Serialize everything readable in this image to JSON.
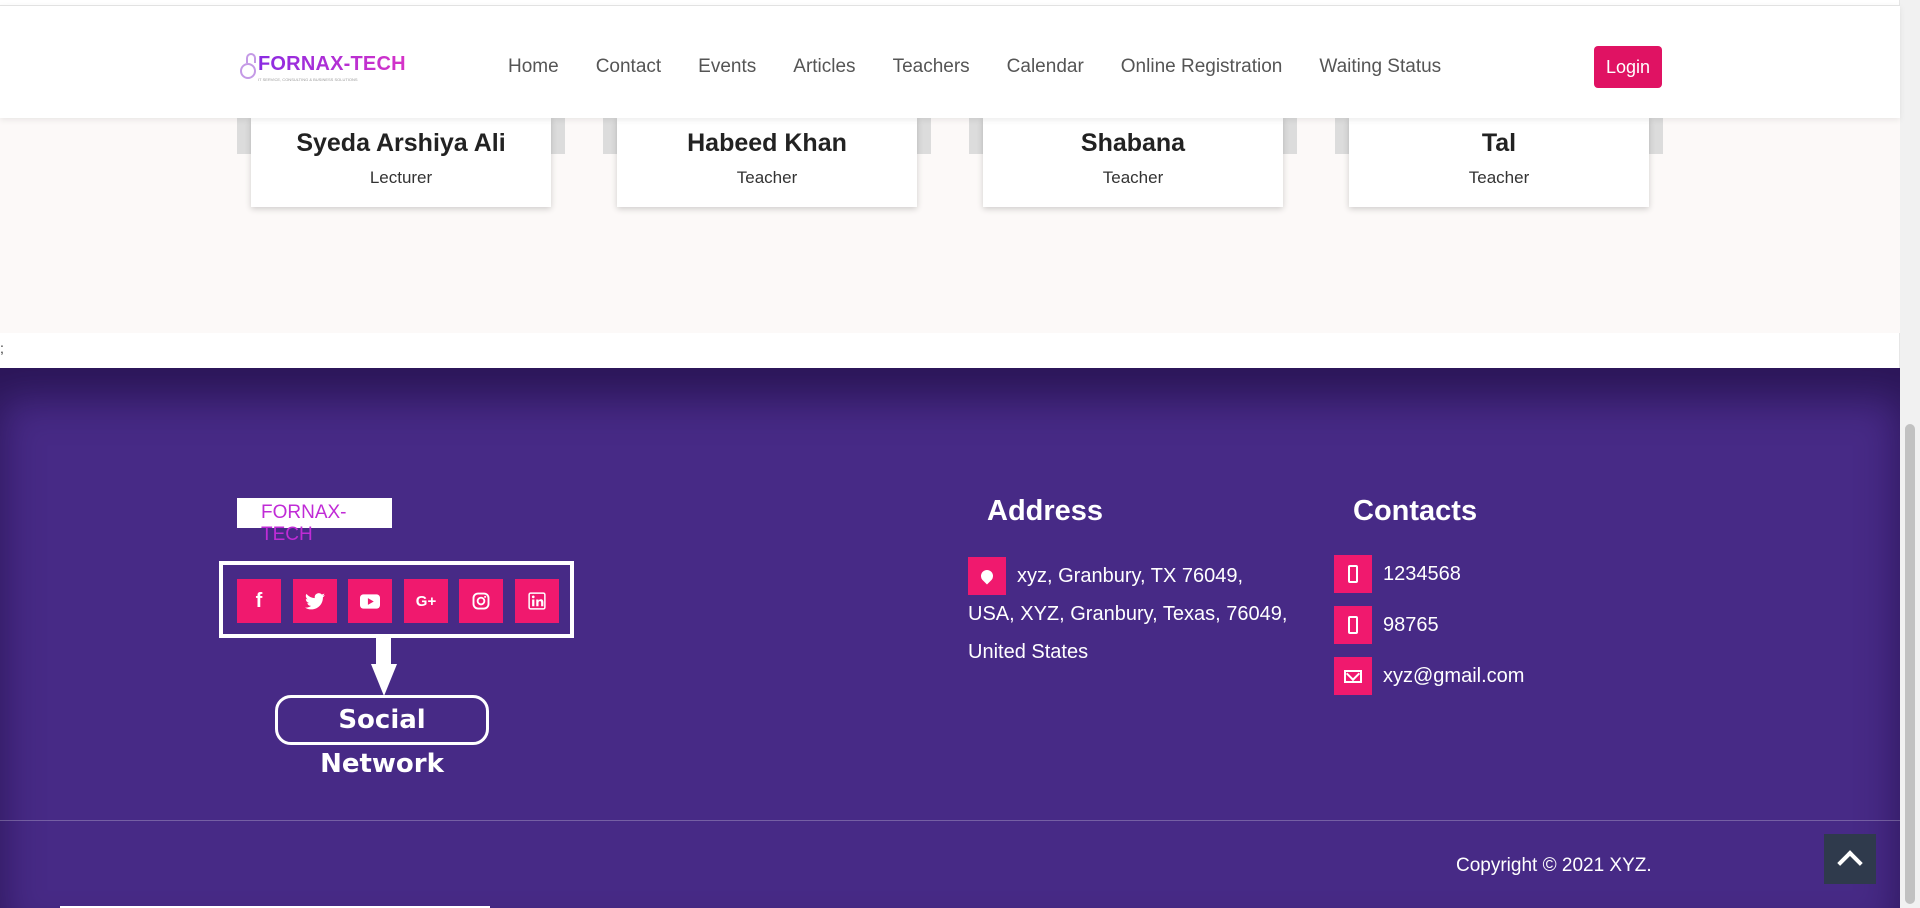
{
  "header": {
    "logo_text": "FORNAX-TECH",
    "logo_tagline": "IT SERVICE, CONSULTING & BUSINESS SOLUTIONS",
    "nav_items": [
      "Home",
      "Contact",
      "Events",
      "Articles",
      "Teachers",
      "Calendar",
      "Online Registration",
      "Waiting Status"
    ],
    "login_label": "Login"
  },
  "teachers": [
    {
      "name": "Syeda Arshiya Ali",
      "role": "Lecturer"
    },
    {
      "name": "Habeed Khan",
      "role": "Teacher"
    },
    {
      "name": "Shabana",
      "role": "Teacher"
    },
    {
      "name": "Tal",
      "role": "Teacher"
    }
  ],
  "stray_text": ";",
  "footer": {
    "logo_text": "FORNAX-TECH",
    "social_icons": [
      "facebook-icon",
      "twitter-icon",
      "youtube-icon",
      "google-plus-icon",
      "instagram-icon",
      "linkedin-icon"
    ],
    "social_label": "Social Network",
    "address_title": "Address",
    "address_text": "xyz, Granbury, TX 76049, USA, XYZ, Granbury, Texas, 76049, United States",
    "contacts_title": "Contacts",
    "contacts": [
      "1234568",
      "98765",
      "xyz@gmail.com"
    ],
    "copyright": "Copyright © 2021 XYZ."
  },
  "colors": {
    "accent": "#f0196e",
    "login": "#e01263",
    "footer_bg": "#472a86",
    "scroll_top_bg": "#2f3a4c"
  }
}
